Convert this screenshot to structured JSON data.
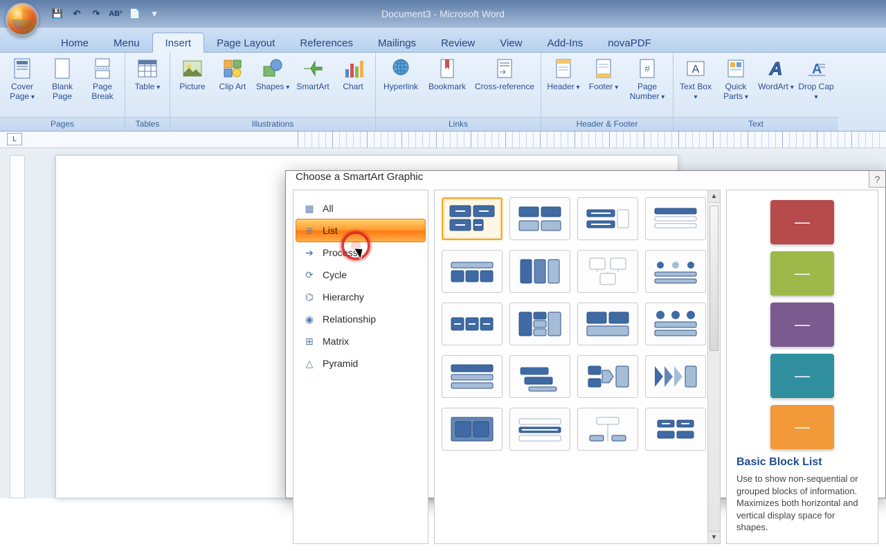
{
  "app_title": "Document3 - Microsoft Word",
  "tabs": {
    "home": "Home",
    "menu": "Menu",
    "insert": "Insert",
    "page_layout": "Page Layout",
    "references": "References",
    "mailings": "Mailings",
    "review": "Review",
    "view": "View",
    "addins": "Add-Ins",
    "novapdf": "novaPDF"
  },
  "ribbon": {
    "groups": {
      "pages": "Pages",
      "tables": "Tables",
      "illustrations": "Illustrations",
      "links": "Links",
      "header_footer": "Header & Footer",
      "text": "Text"
    },
    "buttons": {
      "cover_page": "Cover Page",
      "blank_page": "Blank Page",
      "page_break": "Page Break",
      "table": "Table",
      "picture": "Picture",
      "clip_art": "Clip Art",
      "shapes": "Shapes",
      "smartart": "SmartArt",
      "chart": "Chart",
      "hyperlink": "Hyperlink",
      "bookmark": "Bookmark",
      "cross_reference": "Cross-reference",
      "header": "Header",
      "footer": "Footer",
      "page_number": "Page Number",
      "text_box": "Text Box",
      "quick_parts": "Quick Parts",
      "wordart": "WordArt",
      "drop_cap": "Drop Cap"
    }
  },
  "dialog": {
    "title": "Choose a SmartArt Graphic",
    "categories": {
      "all": "All",
      "list": "List",
      "process": "Process",
      "cycle": "Cycle",
      "hierarchy": "Hierarchy",
      "relationship": "Relationship",
      "matrix": "Matrix",
      "pyramid": "Pyramid"
    },
    "preview": {
      "name": "Basic Block List",
      "desc": "Use to show non-sequential or grouped blocks of information. Maximizes both horizontal and vertical display space for shapes.",
      "colors": [
        "#b74a4a",
        "#9fb84a",
        "#7a5a8f",
        "#2f8f9f",
        "#f29a3a"
      ]
    }
  }
}
